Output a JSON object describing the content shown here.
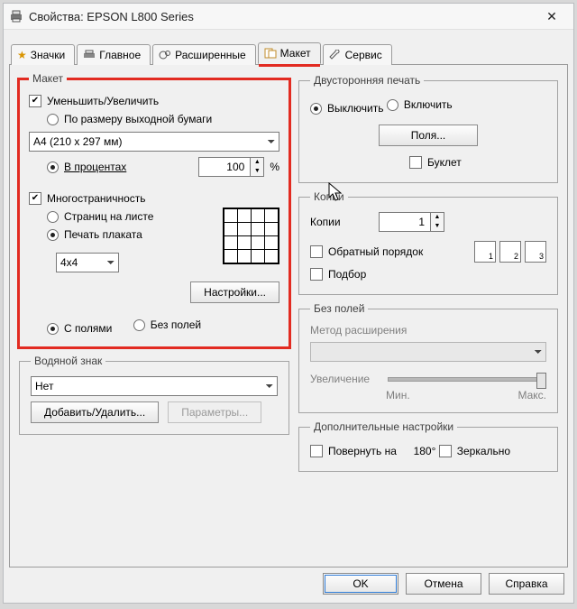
{
  "window": {
    "title": "Свойства: EPSON L800 Series"
  },
  "tabs": {
    "icons": {
      "label": "Значки"
    },
    "main": {
      "label": "Главное"
    },
    "advanced": {
      "label": "Расширенные"
    },
    "layout": {
      "label": "Макет"
    },
    "service": {
      "label": "Сервис"
    },
    "active": "layout"
  },
  "layout": {
    "legend": "Макет",
    "reduce_enlarge": "Уменьшить/Увеличить",
    "fit_to_output": "По размеру выходной бумаги",
    "paper_size": "A4 (210 x 297 мм)",
    "by_percent": "В процентах",
    "percent_value": "100",
    "percent_unit": "%",
    "multipage": "Многостраничность",
    "pages_per_sheet": "Страниц на листе",
    "poster": "Печать плаката",
    "poster_size": "4x4",
    "settings_btn": "Настройки...",
    "with_margins": "С полями",
    "borderless": "Без полей"
  },
  "duplex": {
    "legend": "Двусторонняя печать",
    "off": "Выключить",
    "on": "Включить",
    "margins_btn": "Поля...",
    "booklet": "Буклет"
  },
  "copies": {
    "legend": "Копии",
    "label": "Копии",
    "value": "1",
    "reverse": "Обратный порядок",
    "collate": "Подбор"
  },
  "borderless_opts": {
    "legend": "Без полей",
    "method": "Метод расширения",
    "enlargement": "Увеличение",
    "min": "Мин.",
    "max": "Макс."
  },
  "extra": {
    "legend": "Дополнительные настройки",
    "rotate": "Повернуть на",
    "rotate_deg": "180°",
    "mirror": "Зеркально"
  },
  "watermark": {
    "legend": "Водяной знак",
    "none": "Нет",
    "add_remove": "Добавить/Удалить...",
    "params": "Параметры..."
  },
  "footer": {
    "ok": "OK",
    "cancel": "Отмена",
    "help": "Справка"
  }
}
